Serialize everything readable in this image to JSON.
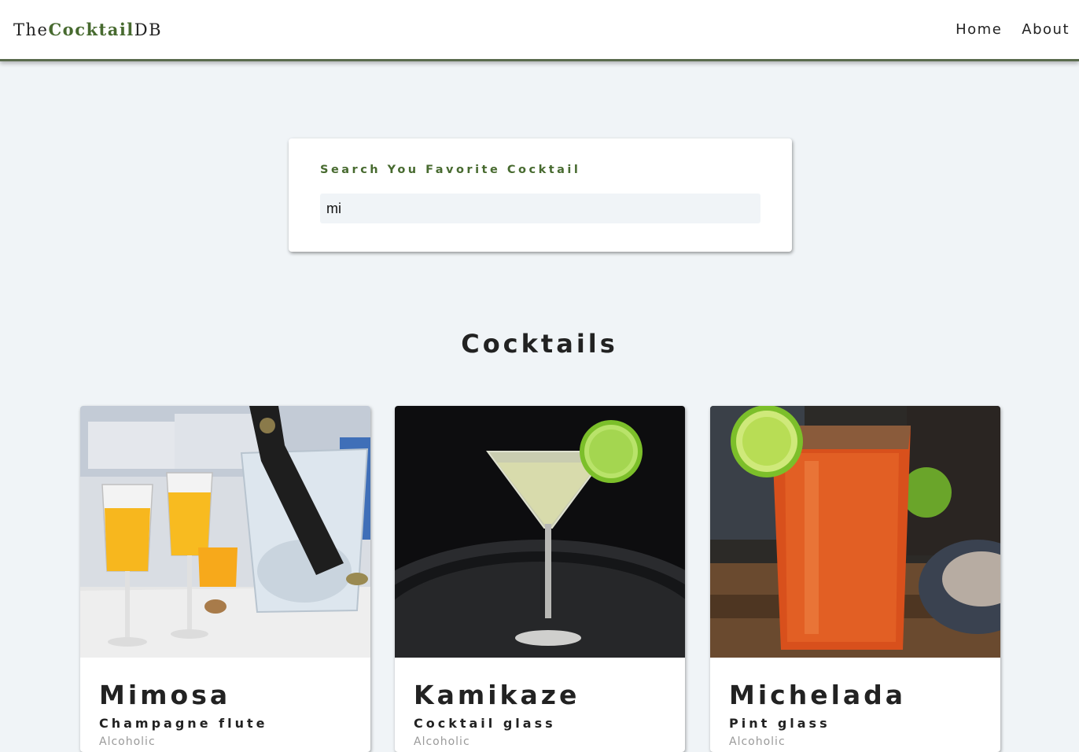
{
  "navbar": {
    "logo_prefix": "The",
    "logo_accent": "Cocktail",
    "logo_suffix": "DB",
    "links": [
      {
        "label": "Home"
      },
      {
        "label": "About"
      }
    ]
  },
  "search": {
    "label": "Search You Favorite Cocktail",
    "value": "mi"
  },
  "section": {
    "title": "Cocktails"
  },
  "cocktails": [
    {
      "name": "Mimosa",
      "glass": "Champagne flute",
      "info": "Alcoholic"
    },
    {
      "name": "Kamikaze",
      "glass": "Cocktail glass",
      "info": "Alcoholic"
    },
    {
      "name": "Michelada",
      "glass": "Pint glass",
      "info": "Alcoholic"
    }
  ],
  "colors": {
    "accent": "#476a2f",
    "background": "#f0f4f7",
    "navbar_border": "#5a6b4e"
  }
}
